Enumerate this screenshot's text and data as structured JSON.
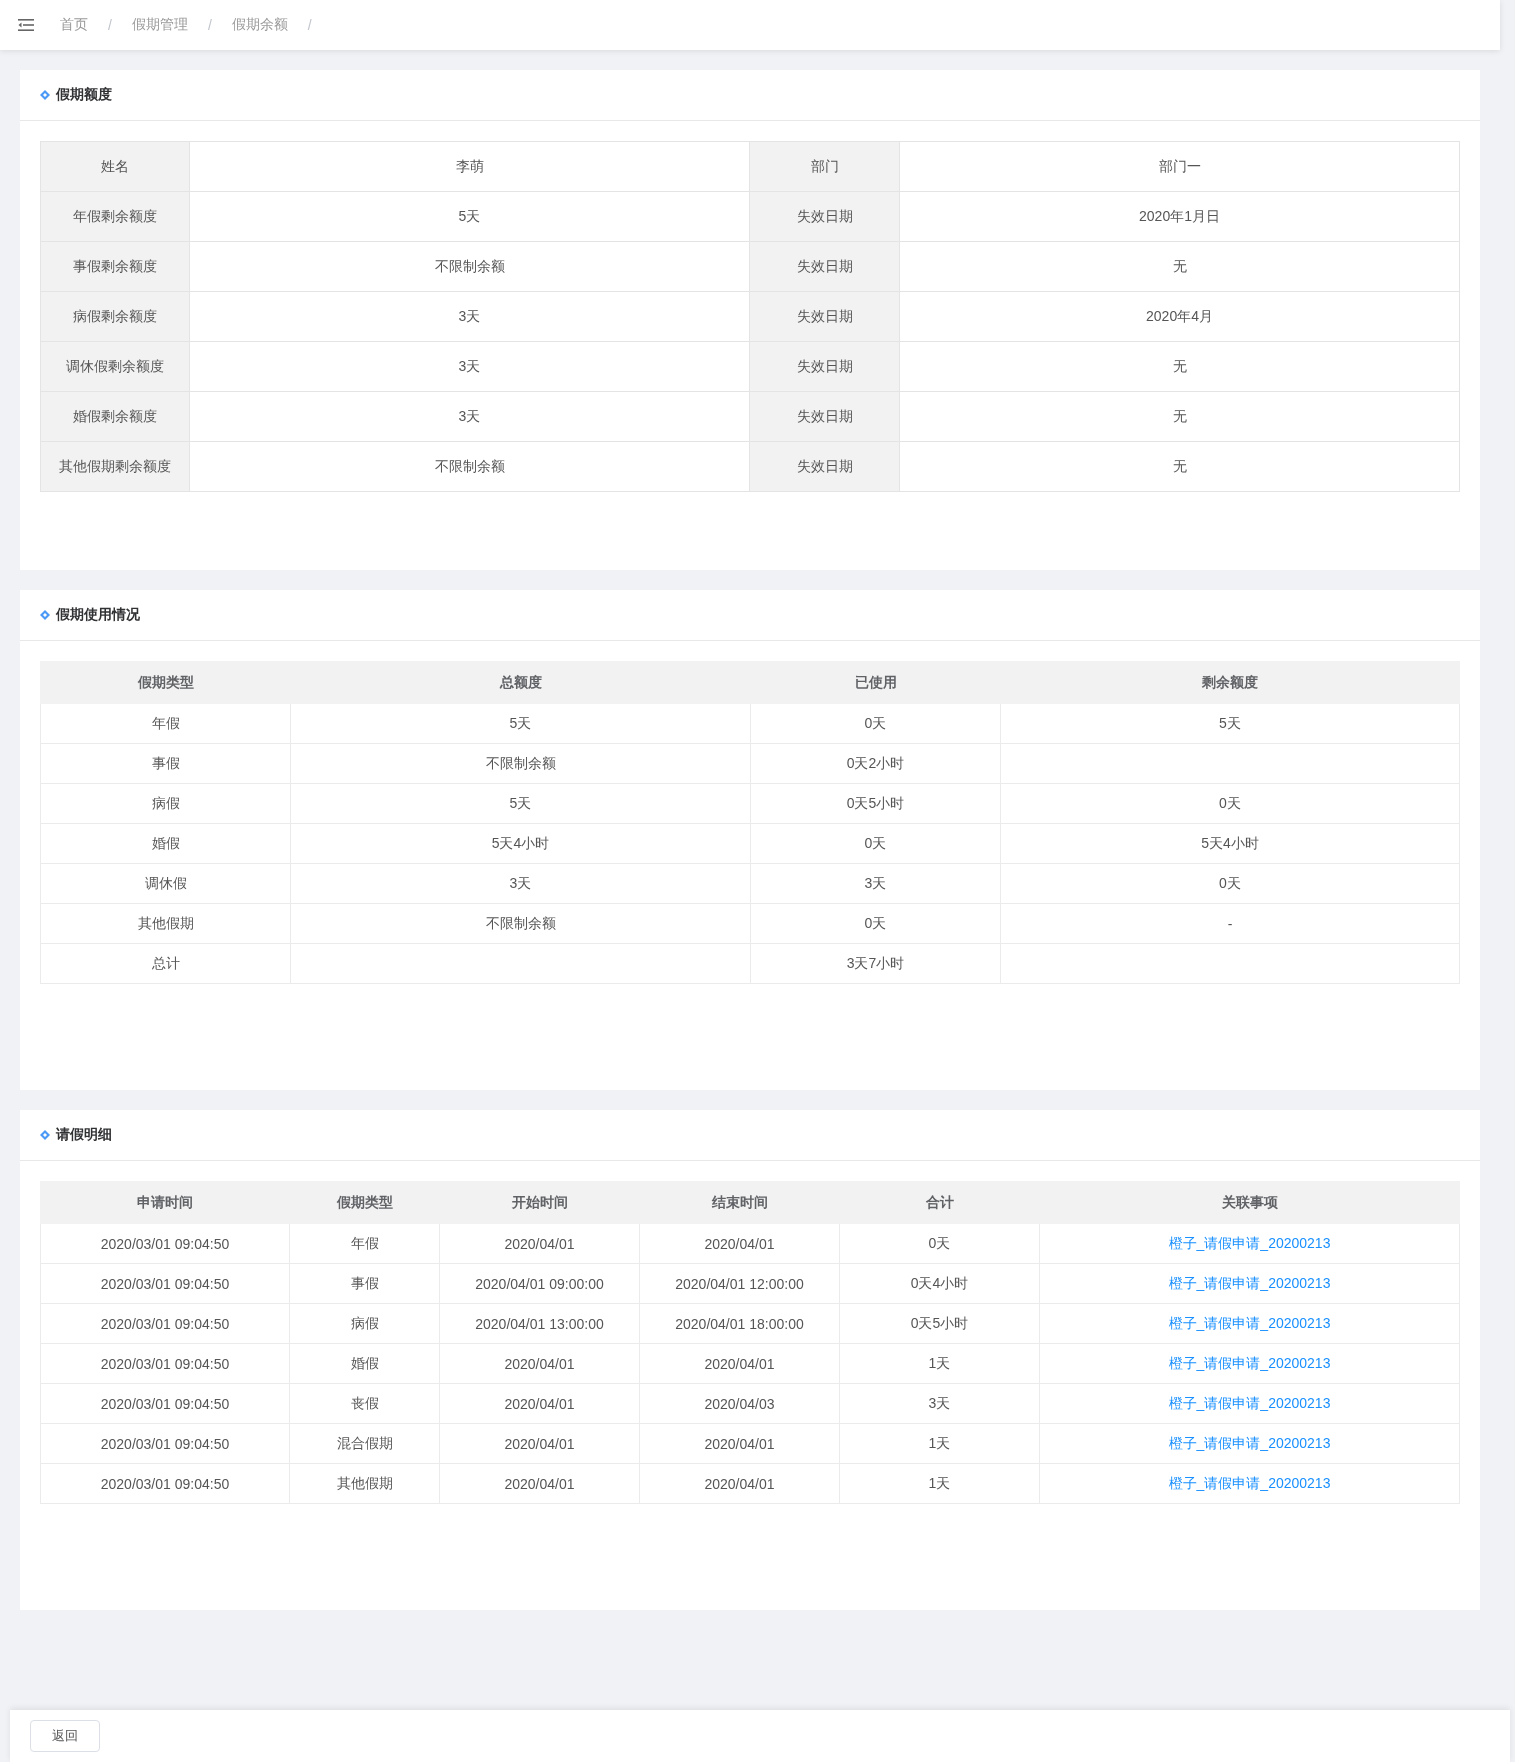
{
  "breadcrumb": [
    {
      "kind": "link",
      "label": "首页"
    },
    {
      "kind": "separator",
      "label": "/"
    },
    {
      "kind": "link",
      "label": "假期管理"
    },
    {
      "kind": "separator",
      "label": "/"
    },
    {
      "kind": "link",
      "label": "假期余额"
    },
    {
      "kind": "separator",
      "label": "/"
    }
  ],
  "quota": {
    "title": "假期额度",
    "rows": [
      [
        "姓名",
        "李萌",
        "部门",
        "部门一"
      ],
      [
        "年假剩余额度",
        "5天",
        "失效日期",
        "2020年1月日"
      ],
      [
        "事假剩余额度",
        "不限制余额",
        "失效日期",
        "无"
      ],
      [
        "病假剩余额度",
        "3天",
        "失效日期",
        "2020年4月"
      ],
      [
        "调休假剩余额度",
        "3天",
        "失效日期",
        "无"
      ],
      [
        "婚假剩余额度",
        "3天",
        "失效日期",
        "无"
      ],
      [
        "其他假期剩余额度",
        "不限制余额",
        "失效日期",
        "无"
      ]
    ]
  },
  "usage": {
    "title": "假期使用情况",
    "columns": [
      "假期类型",
      "总额度",
      "已使用",
      "剩余额度"
    ],
    "rows": [
      [
        "年假",
        "5天",
        "0天",
        "5天"
      ],
      [
        "事假",
        "不限制余额",
        "0天2小时",
        null
      ],
      [
        "病假",
        "5天",
        "0天5小时",
        "0天"
      ],
      [
        "婚假",
        "5天4小时",
        "0天",
        "5天4小时"
      ],
      [
        "调休假",
        "3天",
        "3天",
        "0天"
      ],
      [
        "其他假期",
        "不限制余额",
        "0天",
        "-"
      ],
      [
        "总计",
        null,
        "3天7小时",
        null
      ]
    ]
  },
  "details": {
    "title": "请假明细",
    "columns": [
      "申请时间",
      "假期类型",
      "开始时间",
      "结束时间",
      "合计",
      "关联事项"
    ],
    "rows": [
      [
        "2020/03/01 09:04:50",
        "年假",
        "2020/04/01",
        "2020/04/01",
        "0天",
        "橙子_请假申请_20200213"
      ],
      [
        "2020/03/01 09:04:50",
        "事假",
        "2020/04/01 09:00:00",
        "2020/04/01 12:00:00",
        "0天4小时",
        "橙子_请假申请_20200213"
      ],
      [
        "2020/03/01 09:04:50",
        "病假",
        "2020/04/01 13:00:00",
        "2020/04/01 18:00:00",
        "0天5小时",
        "橙子_请假申请_20200213"
      ],
      [
        "2020/03/01 09:04:50",
        "婚假",
        "2020/04/01",
        "2020/04/01",
        "1天",
        "橙子_请假申请_20200213"
      ],
      [
        "2020/03/01 09:04:50",
        "丧假",
        "2020/04/01",
        "2020/04/03",
        "3天",
        "橙子_请假申请_20200213"
      ],
      [
        "2020/03/01 09:04:50",
        "混合假期",
        "2020/04/01",
        "2020/04/01",
        "1天",
        "橙子_请假申请_20200213"
      ],
      [
        "2020/03/01 09:04:50",
        "其他假期",
        "2020/04/01",
        "2020/04/01",
        "1天",
        "橙子_请假申请_20200213"
      ]
    ]
  },
  "footer": {
    "back_button": "返回"
  }
}
